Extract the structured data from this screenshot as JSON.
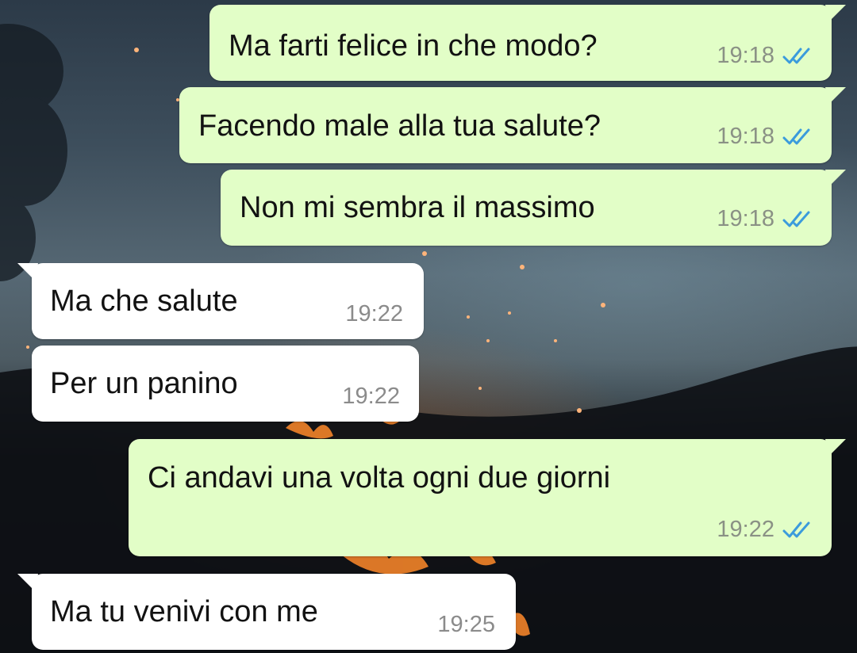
{
  "conversation": {
    "messages": [
      {
        "direction": "outgoing",
        "text": "Ma farti felice in che modo?",
        "time": "19:18",
        "status": "read"
      },
      {
        "direction": "outgoing",
        "text": "Facendo male alla tua salute?",
        "time": "19:18",
        "status": "read"
      },
      {
        "direction": "outgoing",
        "text": "Non mi sembra il massimo",
        "time": "19:18",
        "status": "read"
      },
      {
        "direction": "incoming",
        "text": "Ma che salute",
        "time": "19:22"
      },
      {
        "direction": "incoming",
        "text": "Per un panino",
        "time": "19:22"
      },
      {
        "direction": "outgoing",
        "text": "Ci andavi una volta ogni due giorni",
        "time": "19:22",
        "status": "read"
      },
      {
        "direction": "incoming",
        "text": "Ma tu venivi con me",
        "time": "19:25"
      }
    ]
  },
  "icons": {
    "read_receipt": "double-check-icon"
  },
  "colors": {
    "outgoing_bubble": "#e2fec7",
    "incoming_bubble": "#ffffff",
    "read_tick": "#3b9bdc",
    "timestamp": "#8a9185",
    "text": "#121212"
  }
}
